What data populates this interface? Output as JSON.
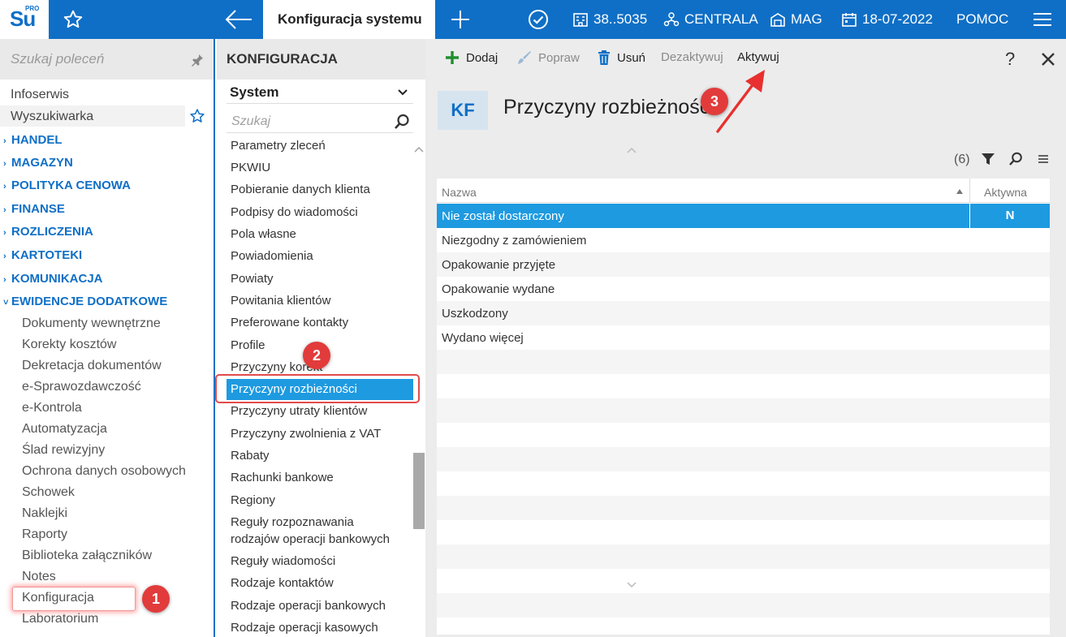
{
  "topbar": {
    "logo": "Su",
    "logo_sup": "PRO",
    "active_tab": "Konfiguracja systemu",
    "firm": "38..5035",
    "centrala": "CENTRALA",
    "mag": "MAG",
    "date": "18-07-2022",
    "pomoc": "POMOC",
    "brand_color": "#0f6fc6"
  },
  "sidebar": {
    "search_placeholder": "Szukaj poleceń",
    "items": [
      "Infoserwis",
      "Wyszukiwarka"
    ],
    "categories": [
      "HANDEL",
      "MAGAZYN",
      "POLITYKA CENOWA",
      "FINANSE",
      "ROZLICZENIA",
      "KARTOTEKI",
      "KOMUNIKACJA",
      "EWIDENCJE DODATKOWE"
    ],
    "subitems": [
      "Dokumenty wewnętrzne",
      "Korekty kosztów",
      "Dekretacja dokumentów",
      "e-Sprawozdawczość",
      "e-Kontrola",
      "Automatyzacja",
      "Ślad rewizyjny",
      "Ochrona danych osobowych",
      "Schowek",
      "Naklejki",
      "Raporty",
      "Biblioteka załączników",
      "Notes",
      "Konfiguracja",
      "Laboratorium"
    ]
  },
  "config": {
    "title": "KONFIGURACJA",
    "select_value": "System",
    "search_placeholder": "Szukaj",
    "items": [
      "Parametry zleceń",
      "PKWIU",
      "Pobieranie danych klienta",
      "Podpisy do wiadomości",
      "Pola własne",
      "Powiadomienia",
      "Powiaty",
      "Powitania klientów",
      "Preferowane kontakty",
      "Profile",
      "Przyczyny korekt",
      "Przyczyny rozbieżności",
      "Przyczyny utraty klientów",
      "Przyczyny zwolnienia z VAT",
      "Rabaty",
      "Rachunki bankowe",
      "Regiony",
      "Reguły rozpoznawania",
      "rodzajów operacji bankowych",
      "Reguły wiadomości",
      "Rodzaje kontaktów",
      "Rodzaje operacji bankowych",
      "Rodzaje operacji kasowych"
    ],
    "selected": "Przyczyny rozbieżności"
  },
  "toolbar": {
    "add": "Dodaj",
    "edit": "Popraw",
    "delete": "Usuń",
    "deactivate": "Dezaktywuj",
    "activate": "Aktywuj",
    "help": "?"
  },
  "content": {
    "badge": "KF",
    "title": "Przyczyny rozbieżności",
    "count": "(6)",
    "columns": [
      "Nazwa",
      "Aktywna"
    ],
    "rows": [
      {
        "name": "Nie został dostarczony",
        "active": "N"
      },
      {
        "name": "Niezgodny z zamówieniem",
        "active": ""
      },
      {
        "name": "Opakowanie przyjęte",
        "active": ""
      },
      {
        "name": "Opakowanie wydane",
        "active": ""
      },
      {
        "name": "Uszkodzony",
        "active": ""
      },
      {
        "name": "Wydano więcej",
        "active": ""
      }
    ]
  },
  "annotations": {
    "step1": "1",
    "step2": "2",
    "step3": "3",
    "color": "#e23b3b"
  }
}
